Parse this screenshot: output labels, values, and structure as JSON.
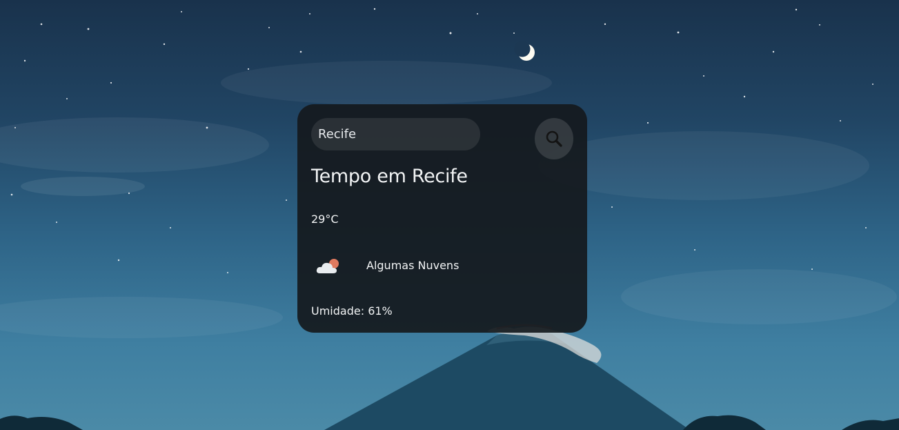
{
  "search": {
    "value": "Recife",
    "button_icon": "search-icon"
  },
  "weather": {
    "title": "Tempo em Recife",
    "temperature": "29°C",
    "icon": "partly-cloudy-icon",
    "description": "Algumas Nuvens",
    "humidity_label": "Umidade:",
    "humidity_value": "61%"
  },
  "colors": {
    "card_background": "#15191d",
    "text": "#f2f4f5",
    "sky_top": "#19324c",
    "sky_bottom": "#4b8aa7"
  }
}
